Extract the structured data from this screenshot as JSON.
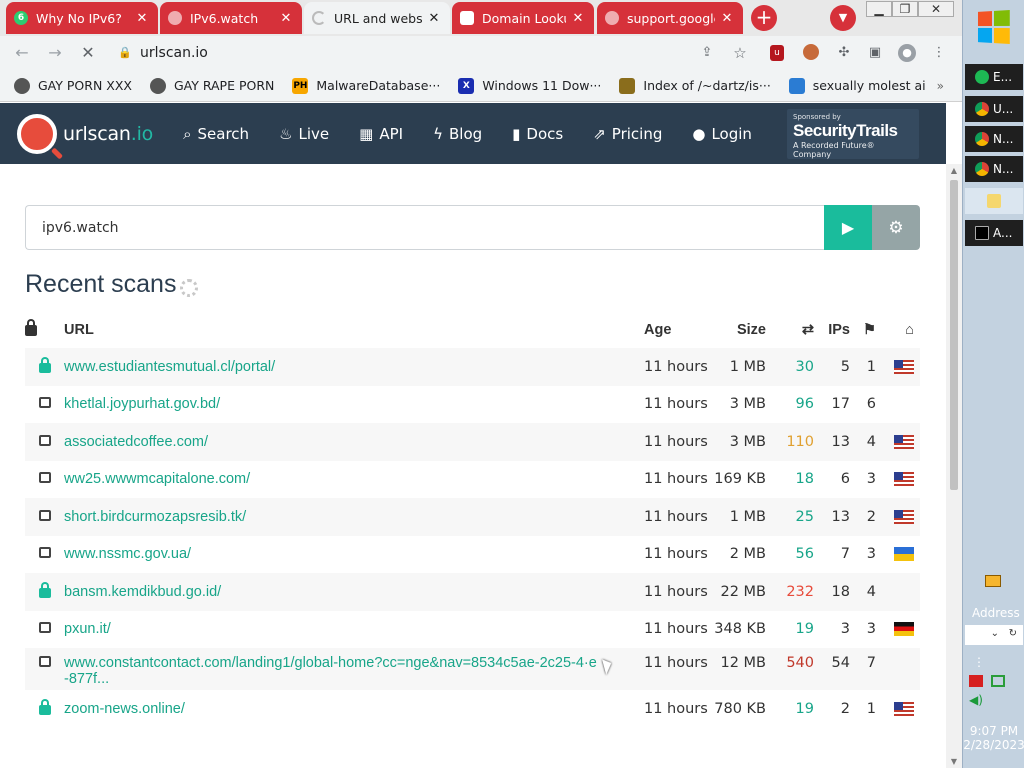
{
  "tabs": [
    {
      "title": "Why No IPv6?",
      "favicon": "6",
      "style": "red",
      "active": false
    },
    {
      "title": "IPv6.watch",
      "favicon": "",
      "style": "red",
      "active": false
    },
    {
      "title": "URL and website",
      "favicon": "",
      "style": "active",
      "active": true
    },
    {
      "title": "Domain Lookup",
      "favicon": "",
      "style": "red",
      "active": false
    },
    {
      "title": "support.google",
      "favicon": "",
      "style": "red",
      "active": false
    }
  ],
  "tab_close_label": "✕",
  "new_tab_label": "+",
  "address_bar": {
    "url": "urlscan.io"
  },
  "bookmarks": [
    {
      "label": "GAY PORN XXX",
      "icon": "globe-icon"
    },
    {
      "label": "GAY RAPE PORN",
      "icon": "globe-icon"
    },
    {
      "label": "MalwareDatabase···",
      "icon": "ph-icon",
      "badge": "PH"
    },
    {
      "label": "Windows 11 Dow···",
      "icon": "x-icon",
      "badge": "X"
    },
    {
      "label": "Index of /~dartz/is···",
      "icon": "folder-icon"
    },
    {
      "label": "sexually molest ai",
      "icon": "doc-icon"
    }
  ],
  "site": {
    "logo_name": "urlscan",
    "logo_tld": ".io",
    "nav": [
      {
        "label": "Search",
        "icon": "search-icon",
        "glyph": "🔍"
      },
      {
        "label": "Live",
        "icon": "fire-icon",
        "glyph": "🔥"
      },
      {
        "label": "API",
        "icon": "qrcode-icon",
        "glyph": "▦"
      },
      {
        "label": "Blog",
        "icon": "bolt-icon",
        "glyph": "⚡"
      },
      {
        "label": "Docs",
        "icon": "bookmark-icon",
        "glyph": "🔖"
      },
      {
        "label": "Pricing",
        "icon": "external-link-icon",
        "glyph": "↗"
      },
      {
        "label": "Login",
        "icon": "user-icon",
        "glyph": "👤"
      }
    ],
    "sponsor": {
      "line1": "Sponsored by",
      "brand": "SecurityTrails",
      "line3": "A Recorded Future® Company"
    }
  },
  "search": {
    "value": "ipv6.watch",
    "go_label": "▶",
    "options_label": "⚙"
  },
  "recent_scans": {
    "title": "Recent scans",
    "columns": {
      "url": "URL",
      "age": "Age",
      "size": "Size",
      "requests_icon": "⇄",
      "ips": "IPs",
      "countries_icon": "⚑",
      "home_icon": "⌂"
    },
    "rows": [
      {
        "lock": "closed",
        "url": "www.estudiantesmutual.cl/portal/",
        "age": "11 hours",
        "size": "1 MB",
        "requests": "30",
        "req_color": "#18a589",
        "ips": "5",
        "countries": "1",
        "flag": "us"
      },
      {
        "lock": "open",
        "url": "khetlal.joypurhat.gov.bd/",
        "age": "11 hours",
        "size": "3 MB",
        "requests": "96",
        "req_color": "#18a589",
        "ips": "17",
        "countries": "6",
        "flag": ""
      },
      {
        "lock": "open",
        "url": "associatedcoffee.com/",
        "age": "11 hours",
        "size": "3 MB",
        "requests": "110",
        "req_color": "#e0a030",
        "ips": "13",
        "countries": "4",
        "flag": "us"
      },
      {
        "lock": "open",
        "url": "ww25.wwwmcapitalone.com/",
        "age": "11 hours",
        "size": "169 KB",
        "requests": "18",
        "req_color": "#18a589",
        "ips": "6",
        "countries": "3",
        "flag": "us"
      },
      {
        "lock": "open",
        "url": "short.birdcurmozapsresib.tk/",
        "age": "11 hours",
        "size": "1 MB",
        "requests": "25",
        "req_color": "#18a589",
        "ips": "13",
        "countries": "2",
        "flag": "us"
      },
      {
        "lock": "open",
        "url": "www.nssmc.gov.ua/",
        "age": "11 hours",
        "size": "2 MB",
        "requests": "56",
        "req_color": "#18a589",
        "ips": "7",
        "countries": "3",
        "flag": "ua"
      },
      {
        "lock": "closed",
        "url": "bansm.kemdikbud.go.id/",
        "age": "11 hours",
        "size": "22 MB",
        "requests": "232",
        "req_color": "#e74c3c",
        "ips": "18",
        "countries": "4",
        "flag": ""
      },
      {
        "lock": "open",
        "url": "pxun.it/",
        "age": "11 hours",
        "size": "348 KB",
        "requests": "19",
        "req_color": "#18a589",
        "ips": "3",
        "countries": "3",
        "flag": "de"
      },
      {
        "lock": "open",
        "url": "www.constantcontact.com/landing1/global-home?cc=nge&nav=8534c5ae-2c25-4·e -877f...",
        "age": "11 hours",
        "size": "12 MB",
        "requests": "540",
        "req_color": "#c0392b",
        "ips": "54",
        "countries": "7",
        "flag": ""
      },
      {
        "lock": "closed",
        "url": "zoom-news.online/",
        "age": "11 hours",
        "size": "780 KB",
        "requests": "19",
        "req_color": "#18a589",
        "ips": "2",
        "countries": "1",
        "flag": "us"
      }
    ]
  },
  "taskbar": {
    "items": [
      {
        "label": "E...",
        "icon": "spotify-icon"
      },
      {
        "label": "U...",
        "icon": "chrome-icon"
      },
      {
        "label": "N...",
        "icon": "chrome-icon"
      },
      {
        "label": "N...",
        "icon": "chrome-icon"
      },
      {
        "label": "",
        "icon": "folder-icon"
      },
      {
        "label": "A...",
        "icon": "cmd-icon"
      }
    ],
    "address_label": "Address",
    "clock_time": "9:07 PM",
    "clock_date": "2/28/2023"
  }
}
